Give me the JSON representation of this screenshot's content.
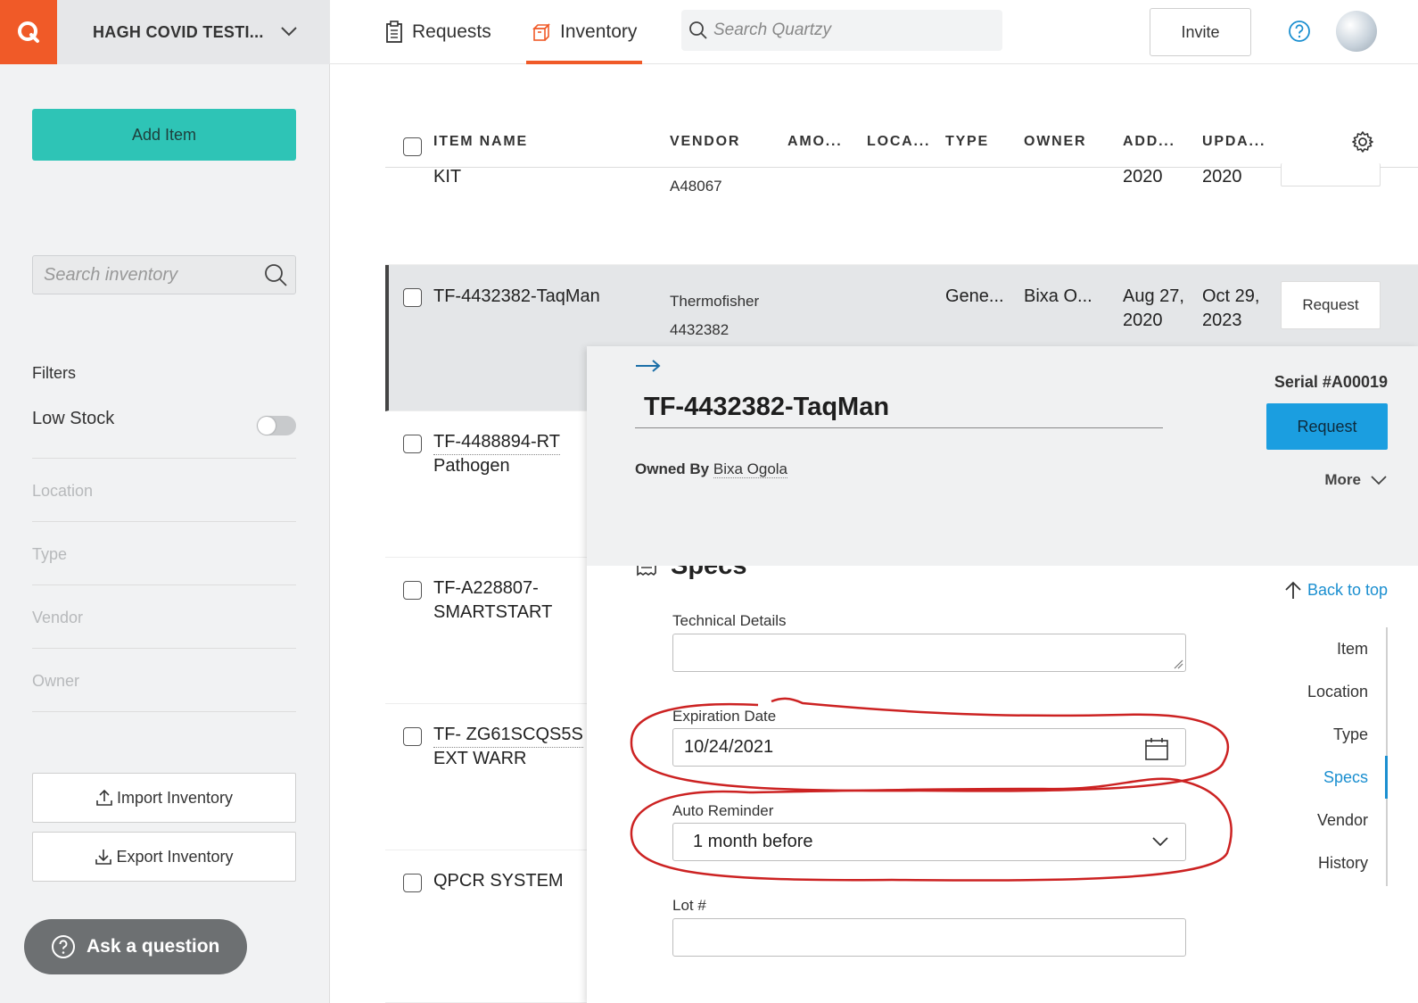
{
  "app": {
    "org_name": "HAGH COVID TESTI..."
  },
  "nav": {
    "requests_label": "Requests",
    "inventory_label": "Inventory",
    "search_placeholder": "Search Quartzy",
    "invite_label": "Invite"
  },
  "sidebar": {
    "add_item_label": "Add Item",
    "search_placeholder": "Search inventory",
    "filters_title": "Filters",
    "low_stock_label": "Low Stock",
    "filters": [
      "Location",
      "Type",
      "Vendor",
      "Owner"
    ],
    "import_label": "Import Inventory",
    "export_label": "Export Inventory",
    "ask_label": "Ask a question"
  },
  "table": {
    "headers": [
      "ITEM NAME",
      "VENDOR",
      "AMO...",
      "LOCA...",
      "TYPE",
      "OWNER",
      "ADD...",
      "UPDA..."
    ],
    "rows": [
      {
        "name": "KIT",
        "vendor_line2": "A48067",
        "added": "2020",
        "updated": "2020"
      },
      {
        "name": "TF-4432382-TaqMan",
        "vendor_line1": "Thermofisher",
        "vendor_line2": "4432382",
        "type": "Gene...",
        "owner": "Bixa O...",
        "added_line1": "Aug 27,",
        "added_line2": "2020",
        "updated_line1": "Oct 29,",
        "updated_line2": "2023",
        "request_label": "Request"
      },
      {
        "name_line1": "TF-4488894-RT",
        "name_line2": "Pathogen"
      },
      {
        "name_line1": "TF-A228807-",
        "name_line2": "SMARTSTART"
      },
      {
        "name_line1": "TF- ZG61SCQS5S",
        "name_line2": "EXT WARR"
      },
      {
        "name": "QPCR SYSTEM"
      }
    ]
  },
  "detail": {
    "title": "TF-4432382-TaqMan",
    "owned_by_label": "Owned By",
    "owner": "Bixa Ogola",
    "serial": "Serial #A00019",
    "request_label": "Request",
    "more_label": "More",
    "section_title": "Specs",
    "back_to_top": "Back to top",
    "technical_details_label": "Technical Details",
    "technical_details_value": "",
    "expiration_label": "Expiration Date",
    "expiration_value": "10/24/2021",
    "reminder_label": "Auto Reminder",
    "reminder_value": "1 month before",
    "lot_label": "Lot #",
    "lot_value": "",
    "subnav": [
      "Item",
      "Location",
      "Type",
      "Specs",
      "Vendor",
      "History"
    ],
    "subnav_active": "Specs"
  },
  "colors": {
    "brand_orange": "#f05a28",
    "add_item_teal": "#2ec4b6",
    "request_blue": "#1b9ee0",
    "annotation_red": "#cc2222"
  }
}
